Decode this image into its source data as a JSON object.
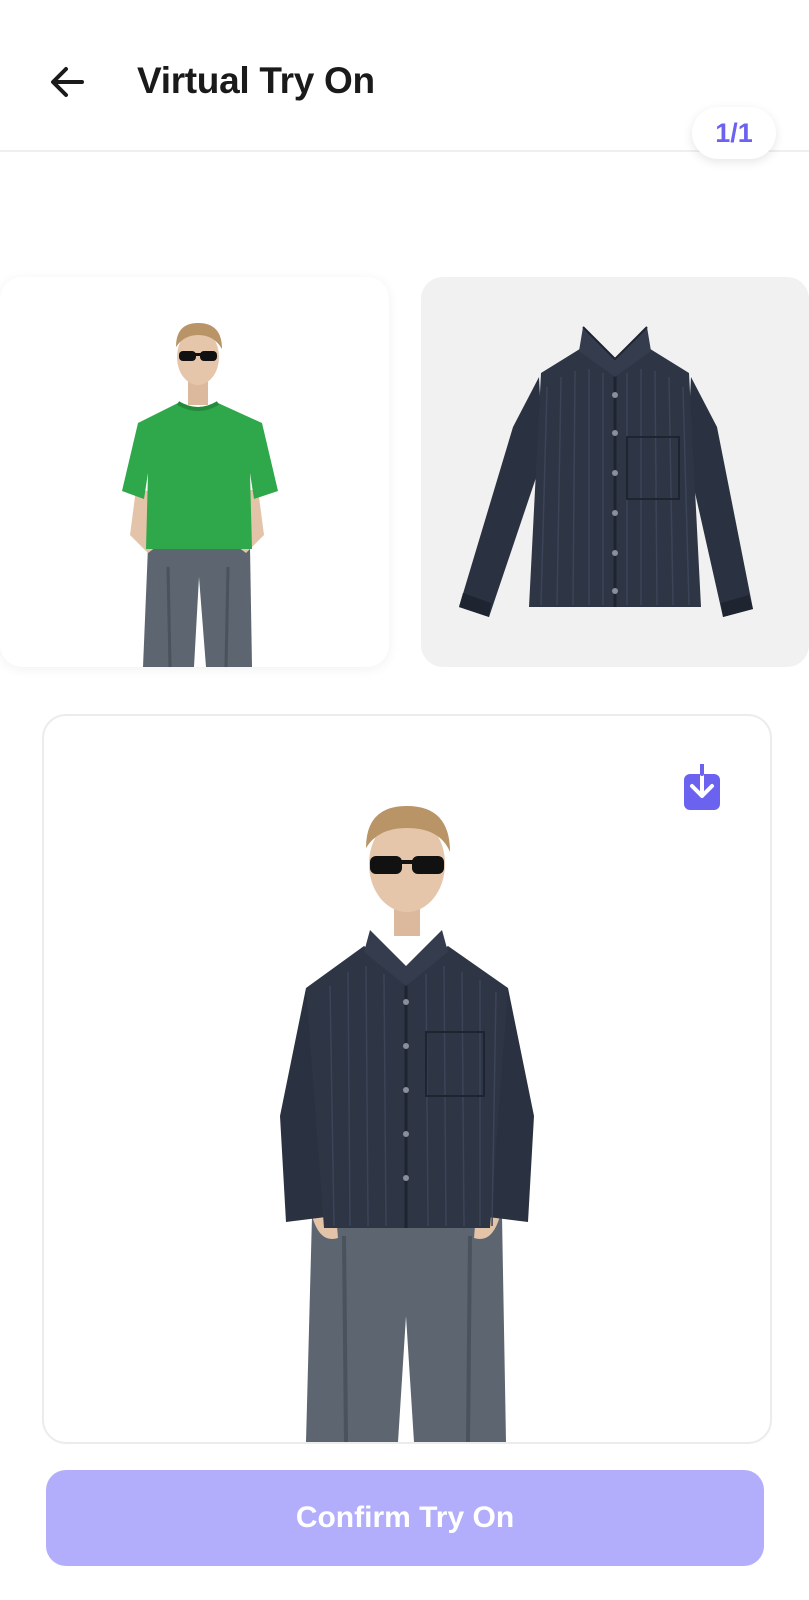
{
  "header": {
    "back_icon": "arrow-left-icon",
    "title": "Virtual Try On",
    "counter": "1/1"
  },
  "model_photo": {
    "icon": "person-green-tshirt-image"
  },
  "garment_photo": {
    "icon": "navy-corduroy-shirt-image"
  },
  "result": {
    "image": "person-wearing-navy-shirt-image",
    "download_icon": "download-icon"
  },
  "confirm_button": {
    "label": "Confirm Try On"
  },
  "colors": {
    "accent": "#6b63f0",
    "button_disabled": "#b3aefc",
    "shirt": "#2a3140",
    "tshirt": "#2ea84a",
    "jeans": "#5c6570"
  }
}
